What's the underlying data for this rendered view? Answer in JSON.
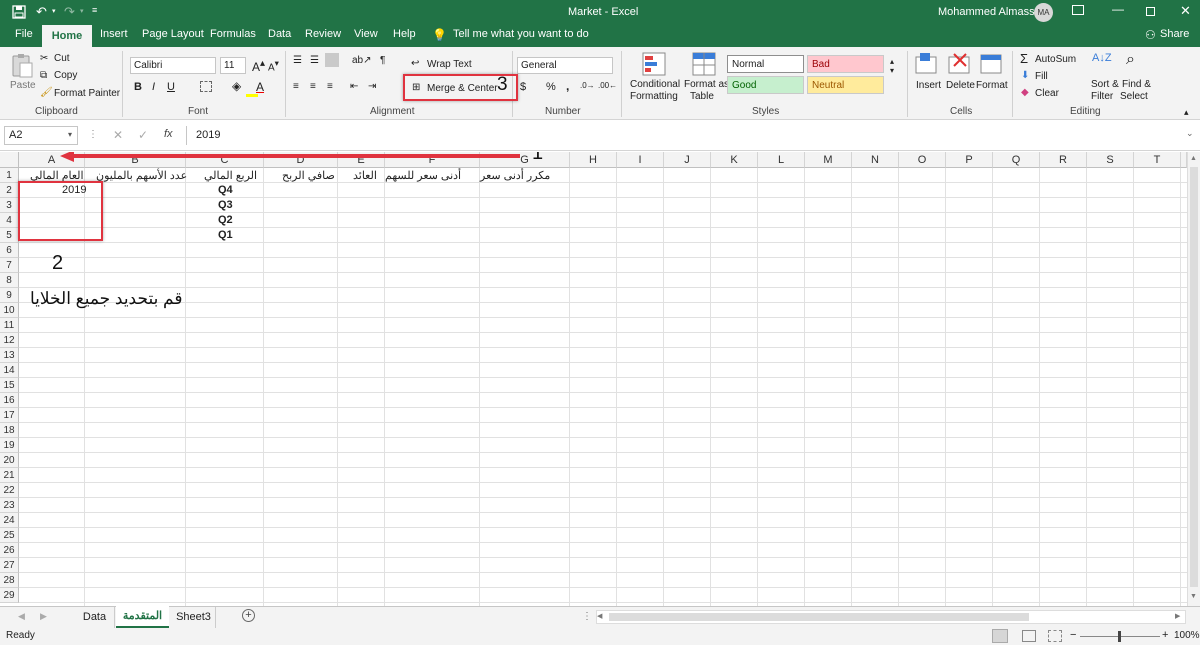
{
  "window": {
    "title": "Market  -  Excel",
    "user": "Mohammed Almasseri",
    "initials": "MA"
  },
  "tabs": [
    "File",
    "Home",
    "Insert",
    "Page Layout",
    "Formulas",
    "Data",
    "Review",
    "View",
    "Help"
  ],
  "tell_me": "Tell me what you want to do",
  "share": "Share",
  "clipboard": {
    "paste": "Paste",
    "cut": "Cut",
    "copy": "Copy",
    "format_painter": "Format Painter",
    "group": "Clipboard"
  },
  "font": {
    "name": "Calibri",
    "size": "11",
    "group": "Font"
  },
  "alignment": {
    "wrap": "Wrap Text",
    "merge": "Merge & Center",
    "group": "Alignment"
  },
  "number": {
    "format": "General",
    "currency": "$",
    "percent": "%",
    "comma": ",",
    "group": "Number"
  },
  "styles": {
    "cond1": "Conditional",
    "cond2": "Formatting",
    "fmt1": "Format as",
    "fmt2": "Table",
    "normal": "Normal",
    "bad": "Bad",
    "good": "Good",
    "neutral": "Neutral",
    "group": "Styles"
  },
  "cells": {
    "insert": "Insert",
    "delete": "Delete",
    "format": "Format",
    "group": "Cells"
  },
  "editing": {
    "autosum": "AutoSum",
    "fill": "Fill",
    "clear": "Clear",
    "sort1": "Sort &",
    "sort2": "Filter",
    "find1": "Find &",
    "find2": "Select",
    "group": "Editing"
  },
  "formula": {
    "namebox": "A2",
    "fx": "fx",
    "value": "2019"
  },
  "columns": [
    "A",
    "B",
    "C",
    "D",
    "E",
    "F",
    "G",
    "H",
    "I",
    "J",
    "K",
    "L",
    "M",
    "N",
    "O",
    "P",
    "Q",
    "R",
    "S",
    "T"
  ],
  "rows": [
    "1",
    "2",
    "3",
    "4",
    "5",
    "6",
    "7",
    "8",
    "9",
    "10",
    "11",
    "12",
    "13",
    "14",
    "15",
    "16",
    "17",
    "18",
    "19",
    "20",
    "21",
    "22",
    "23",
    "24",
    "25",
    "26",
    "27",
    "28",
    "29"
  ],
  "cells_data": {
    "a1": "العام المالي",
    "b1": "عدد الأسهم بالمليون",
    "c1": "الربع المالي",
    "d1": "صافي الربح",
    "e1": "العائد",
    "f1": "أدنى سعر للسهم",
    "g1": "مكرر أدنى سعر",
    "a2": "2019",
    "c2": "Q4",
    "c3": "Q3",
    "c4": "Q2",
    "c5": "Q1"
  },
  "annotations": {
    "n1": "1",
    "n2": "2",
    "n3": "3",
    "instruction": "قم بتحديد جميع الخلايا"
  },
  "sheets": [
    "Data",
    "المتقدمة",
    "Sheet3"
  ],
  "status": {
    "ready": "Ready",
    "zoom": "100%"
  },
  "colors": {
    "brand": "#217346",
    "annotation": "#e0333f"
  }
}
